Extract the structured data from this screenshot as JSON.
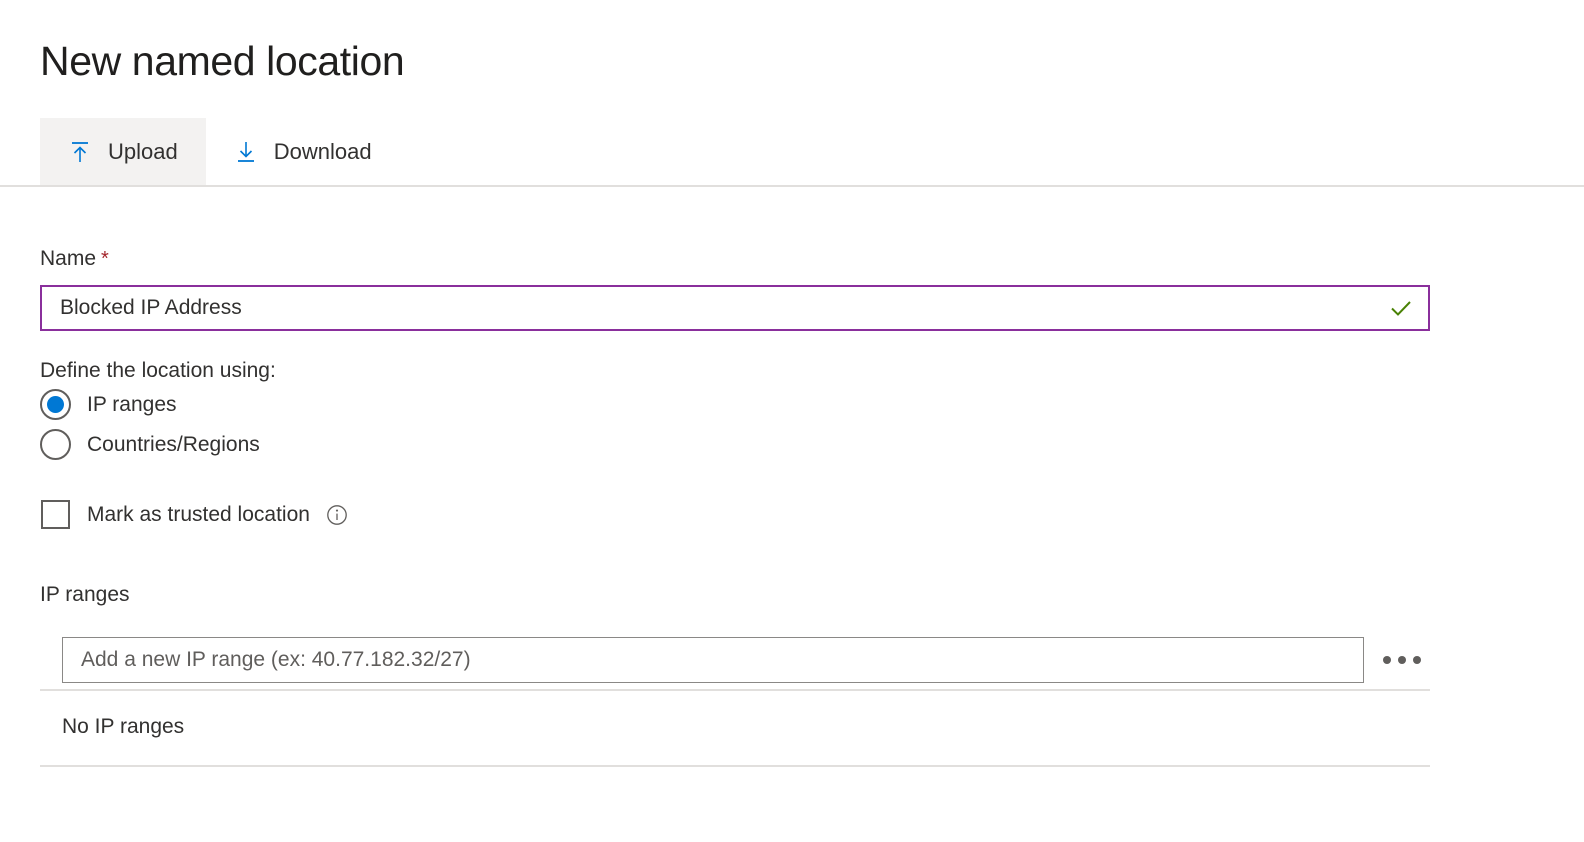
{
  "page": {
    "title": "New named location"
  },
  "command_bar": {
    "buttons": [
      {
        "label": "Upload",
        "icon": "upload-icon",
        "state": "hovered"
      },
      {
        "label": "Download",
        "icon": "download-icon",
        "state": "default"
      }
    ]
  },
  "form": {
    "name_field": {
      "label": "Name",
      "required_marker": "*",
      "value": "Blocked IP Address",
      "placeholder": "",
      "validation_icon": "checkmark-icon",
      "border_color": "#8a2f9c",
      "valid_color": "#498205"
    },
    "location_type": {
      "label": "Define the location using:",
      "selected": "IP ranges",
      "options": [
        {
          "label": "IP ranges",
          "checked": true
        },
        {
          "label": "Countries/Regions",
          "checked": false
        }
      ],
      "accent_color": "#0078d4"
    },
    "trusted_location": {
      "label": "Mark as trusted location",
      "checked": false,
      "info_icon": "info-icon"
    },
    "ip_ranges": {
      "section_label": "IP ranges",
      "add_input": {
        "value": "",
        "placeholder": "Add a new IP range (ex: 40.77.182.32/27)"
      },
      "more_actions_icon": "ellipsis-icon",
      "empty_message": "No IP ranges",
      "rows": []
    }
  },
  "colors": {
    "text": "#323130",
    "title": "#201f1e",
    "accent_blue": "#0078d4",
    "required_red": "#a4262c",
    "divider": "#e1dfdd",
    "hover_bg": "#f3f2f1"
  }
}
